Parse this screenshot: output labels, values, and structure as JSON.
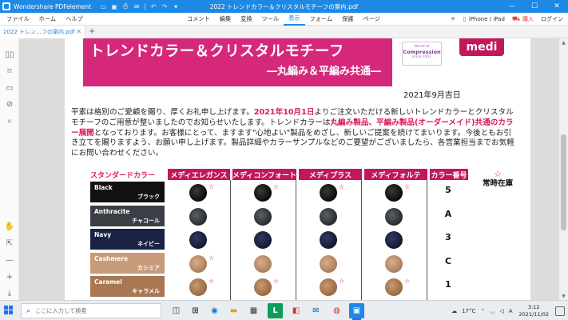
{
  "titlebar": {
    "app_name": "Wondershare PDFelement",
    "document_title": "2022 トレンドカラー＆クリスタルモチーフの案内.pdf",
    "minimize": "—",
    "maximize": "☐",
    "close": "✕"
  },
  "menubar": {
    "left": [
      "ファイル",
      "ホーム",
      "ヘルプ"
    ],
    "center": [
      "コメント",
      "編集",
      "変換",
      "ツール",
      "表示",
      "フォーム",
      "保護",
      "ページ"
    ],
    "active_index": 4,
    "device": "iPhone / iPad",
    "buy": "購入",
    "login": "ログイン"
  },
  "tabs": [
    {
      "label": "2022 トレン…フの案内.pdf"
    }
  ],
  "add_tab": "+",
  "document": {
    "banner_title": "トレンドカラー＆クリスタルモチーフ",
    "banner_subtitle": "―丸編み＆平編み共通―",
    "logo_small": "World of",
    "logo_big": "Compression",
    "logo_since": "since 1951",
    "brand": "medi",
    "date": "2021年9月吉日",
    "paragraph": {
      "p1": "平素は格別のご愛顧を賜り、厚くお礼申し上げます。",
      "p2": "2021年10月1日",
      "p3": "よりご注文いただける新しいトレンドカラーとクリスタルモチーフのご用意が整いましたのでお知らせいたします。トレンドカラーは",
      "p4": "丸編み製品、平編み製品(オーダーメイド)共通のカラー展開",
      "p5": "となっております。お客様にとって、ますます\"心地よい\"製品をめざし、新しいご提案を続けてまいります。今後ともお引き立てを賜りますよう、お願い申し上げます。製品詳細やカラーサンプルなどのご要望がございましたら、各営業担当までお気軽にお問い合わせください。"
    },
    "table": {
      "headers": [
        "スタンダードカラー",
        "メディエレガンス",
        "メディコンフォート",
        "メディプラス",
        "メディフォルテ",
        "カラー番号"
      ],
      "always_stock_star": "☆",
      "always_stock": "常時在庫",
      "star": "☆",
      "rows": [
        {
          "en": "Black",
          "ja": "ブラック",
          "code": "5",
          "label_color": "#111111"
        },
        {
          "en": "Anthracite",
          "ja": "チャコール",
          "code": "A",
          "label_color": "#3b3f45"
        },
        {
          "en": "Navy",
          "ja": "ネイビー",
          "code": "3",
          "label_color": "#1b2344"
        },
        {
          "en": "Cashmere",
          "ja": "カシミア",
          "code": "C",
          "label_color": "#c89b7b"
        },
        {
          "en": "Caramel",
          "ja": "キャラメル",
          "code": "1",
          "label_color": "#a87753"
        }
      ]
    }
  },
  "taskbar": {
    "search_placeholder": "ここに入力して検索",
    "temperature": "17°C",
    "ime": "A",
    "time": "3:12",
    "date": "2021/11/02"
  },
  "colors": {
    "accent": "#1e88e5",
    "pink": "#d81b60",
    "banner": "#d6287b"
  }
}
